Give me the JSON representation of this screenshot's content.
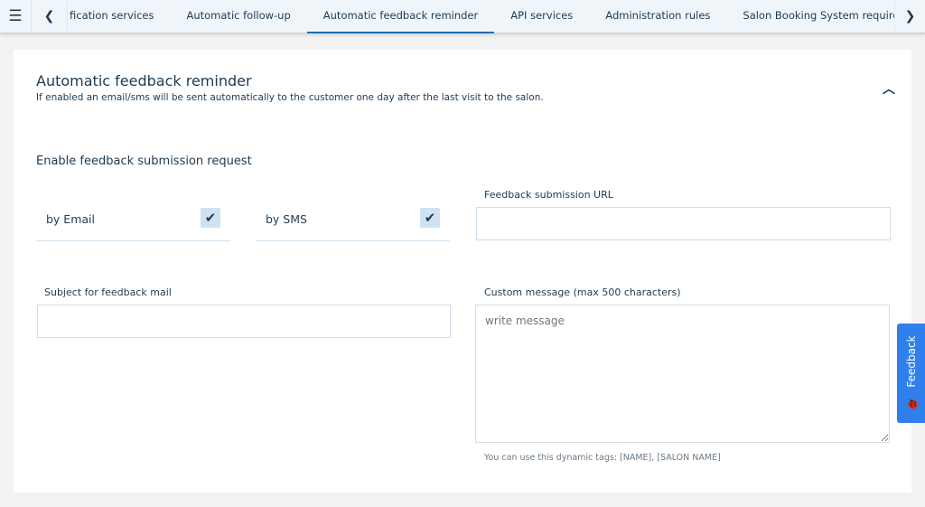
{
  "nav": {
    "tabs": [
      "fication services",
      "Automatic follow-up",
      "Automatic feedback reminder",
      "API services",
      "Administration rules",
      "Salon Booking System required pages"
    ],
    "active": 2
  },
  "section": {
    "title": "Automatic feedback reminder",
    "subtitle": "If enabled an email/sms will be sent automatically to the customer one day after the last visit to the salon."
  },
  "form": {
    "enable_label": "Enable feedback submission request",
    "by_email": "by Email",
    "by_email_checked": true,
    "by_sms": "by SMS",
    "by_sms_checked": true,
    "url_label": "Feedback submission URL",
    "url_value": "",
    "subject_label": "Subject for feedback mail",
    "subject_value": "",
    "message_label": "Custom message (max 500 characters)",
    "message_placeholder": "write message",
    "hint": "You can use this dynamic tags: [NAME], [SALON NAME]"
  },
  "feedback_button": "Feedback",
  "colors": {
    "accent": "#1a6fb5",
    "feedback": "#2f80ed",
    "checkbox": "#cfe2f3"
  }
}
